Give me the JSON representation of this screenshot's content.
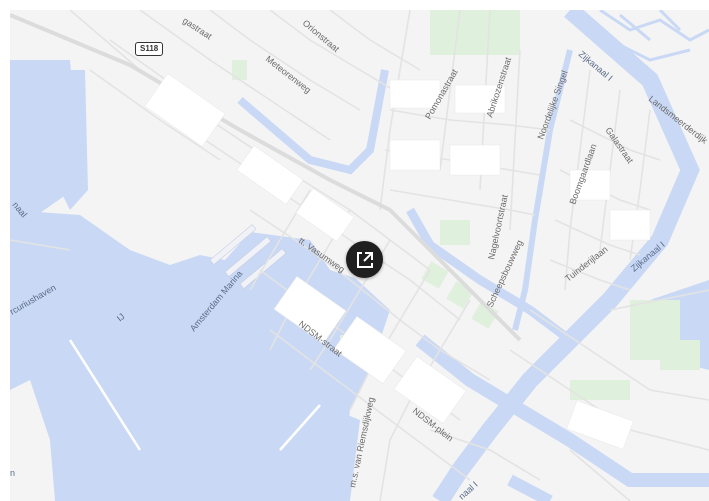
{
  "colors": {
    "water": "#c9d9f5",
    "land": "#f4f4f4",
    "block": "#ffffff",
    "park": "#dff0dc",
    "road": "#e2e2e2",
    "button_bg": "#1f1f1f",
    "button_icon": "#ffffff"
  },
  "map": {
    "route_shield": "S118",
    "labels": {
      "gastraat": "gastraat",
      "orionstraat": "Orionstraat",
      "meteorenweg": "Meteorenweg",
      "pomonastraat": "Pomonastraat",
      "abrikozenstraat": "Abrikozenstraat",
      "noordelijke_singel": "Noordelijke Singel",
      "zijkanaal_i_top": "Zijkanaal I",
      "landsmeerderdijk": "Landsmeerderdijk",
      "galastraat": "Galastraat",
      "boomgaardlaan": "Boomgaardlaan",
      "nagelvoortstraat": "Nagelvoortstraat",
      "scheepsbouwweg": "Scheepsbouwweg",
      "tuinderijlaan": "Tuinderijlaan",
      "zijkanaal_i_right": "Zijkanaal I",
      "naal": "naal",
      "vasumweg": "tt. Vasumweg",
      "amsterdam_marina": "Amsterdam Marina",
      "mercuriushaven": "rcuriushaven",
      "ij": "IJ",
      "ndsm_straat": "NDSM-straat",
      "ndsm_plein": "NDSM-plein",
      "ms_van_riemsdijkweg": "m.s. van Riemsdijkweg",
      "kanaal_bottom": "naal I",
      "n_bottom": "n"
    }
  },
  "controls": {
    "expand_icon": "expand-icon"
  }
}
